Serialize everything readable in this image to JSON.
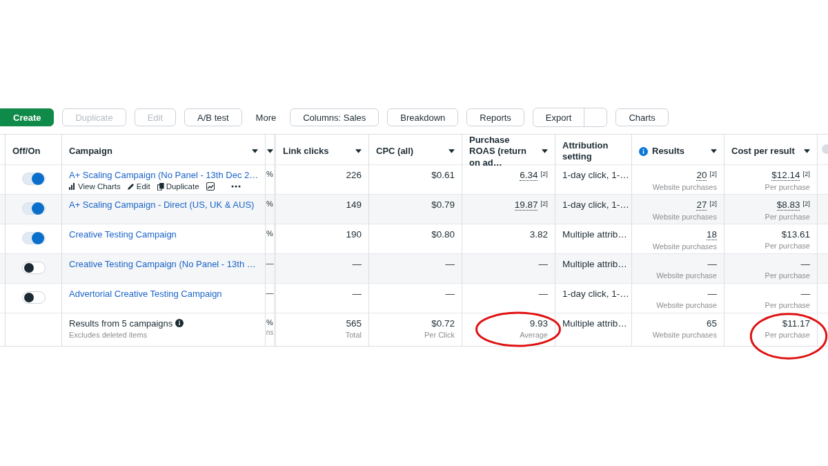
{
  "toolbar": [
    {
      "label": "Create",
      "kind": "primary",
      "disabled": false
    },
    {
      "label": "Duplicate",
      "kind": "plain",
      "disabled": true
    },
    {
      "label": "Edit",
      "kind": "plain",
      "disabled": true
    },
    {
      "label": "A/B test",
      "kind": "plain",
      "disabled": false
    },
    {
      "label": "More",
      "kind": "text",
      "disabled": false
    },
    {
      "label": "Columns: Sales",
      "kind": "plain",
      "disabled": false
    },
    {
      "label": "Breakdown",
      "kind": "plain",
      "disabled": false
    },
    {
      "label": "Reports",
      "kind": "plain",
      "disabled": false
    },
    {
      "label": "Export",
      "kind": "split",
      "disabled": false
    },
    {
      "label": "Charts",
      "kind": "plain",
      "disabled": false
    }
  ],
  "table": {
    "columns": [
      {
        "label": "Off/On",
        "sortable": false,
        "info": false
      },
      {
        "label": "Campaign",
        "sortable": true,
        "info": false
      },
      {
        "sortable": true,
        "info": false
      },
      {
        "label": "Link clicks",
        "sortable": true,
        "info": false
      },
      {
        "label": "CPC (all)",
        "sortable": true,
        "info": false
      },
      {
        "label": "Purchase ROAS (return on ad…",
        "sortable": true,
        "info": false
      },
      {
        "label": "Attribution setting",
        "sortable": false,
        "info": false
      },
      {
        "label": "Results",
        "sortable": true,
        "info": true
      },
      {
        "label": "Cost per result",
        "sortable": true,
        "info": false
      }
    ],
    "rows": [
      {
        "on": true,
        "campaign": "A+ Scaling Campaign (No Panel - 13th Dec 2…",
        "actions": [
          "View Charts",
          "Edit",
          "Duplicate"
        ],
        "column_3": "%",
        "link_clicks": "226",
        "cpc": "$0.61",
        "roas": {
          "value": "6.34",
          "note": "[2]",
          "dotted": true
        },
        "attribution": "1-day click, 1-…",
        "results": {
          "value": "20",
          "note": "[2]",
          "dotted": true,
          "sub": "Website purchases"
        },
        "cost": {
          "value": "$12.14",
          "note": "[2]",
          "dotted": true,
          "sub": "Per purchase"
        }
      },
      {
        "on": true,
        "campaign": "A+ Scaling Campaign - Direct (US, UK & AUS)",
        "actions": [],
        "column_3": "%",
        "link_clicks": "149",
        "cpc": "$0.79",
        "roas": {
          "value": "19.87",
          "note": "[2]",
          "dotted": true
        },
        "attribution": "1-day click, 1-…",
        "results": {
          "value": "27",
          "note": "[2]",
          "dotted": true,
          "sub": "Website purchases"
        },
        "cost": {
          "value": "$8.83",
          "note": "[2]",
          "dotted": true,
          "sub": "Per purchase"
        }
      },
      {
        "on": true,
        "campaign": "Creative Testing Campaign",
        "actions": [],
        "column_3": "%",
        "link_clicks": "190",
        "cpc": "$0.80",
        "roas": {
          "value": "3.82",
          "dotted": false
        },
        "attribution": "Multiple attrib…",
        "results": {
          "value": "18",
          "dotted": true,
          "sub": "Website purchases"
        },
        "cost": {
          "value": "$13.61",
          "dotted": false,
          "sub": "Per purchase"
        }
      },
      {
        "on": false,
        "campaign": "Creative Testing Campaign (No Panel - 13th …",
        "actions": [],
        "column_3": "—",
        "link_clicks": "—",
        "cpc": "—",
        "roas": {
          "value": "—",
          "dotted": false
        },
        "attribution": "Multiple attrib…",
        "results": {
          "value": "—",
          "dotted": false,
          "sub": "Website purchase"
        },
        "cost": {
          "value": "—",
          "dotted": false,
          "sub": "Per purchase"
        }
      },
      {
        "on": false,
        "campaign": "Advertorial Creative Testing Campaign",
        "actions": [],
        "column_3": "—",
        "link_clicks": "—",
        "cpc": "—",
        "roas": {
          "value": "—",
          "dotted": false
        },
        "attribution": "1-day click, 1-…",
        "results": {
          "value": "—",
          "dotted": false,
          "sub": "Website purchase"
        },
        "cost": {
          "value": "—",
          "dotted": false,
          "sub": "Per purchase"
        }
      }
    ],
    "summary": {
      "title": "Results from 5 campaigns",
      "note": "Excludes deleted items",
      "column_3": {
        "value": "%",
        "sub": "ns"
      },
      "link_clicks": {
        "value": "565",
        "sub": "Total",
        "circled": false
      },
      "cpc": {
        "value": "$0.72",
        "sub": "Per Click",
        "circled": false
      },
      "roas": {
        "value": "9.93",
        "sub": "Average",
        "circled": true
      },
      "attribution": {
        "value": "Multiple attrib…",
        "circled": false
      },
      "results": {
        "value": "65",
        "sub": "Website purchases",
        "circled": false
      },
      "cost": {
        "value": "$11.17",
        "sub": "Per purchase",
        "circled": true
      }
    }
  }
}
